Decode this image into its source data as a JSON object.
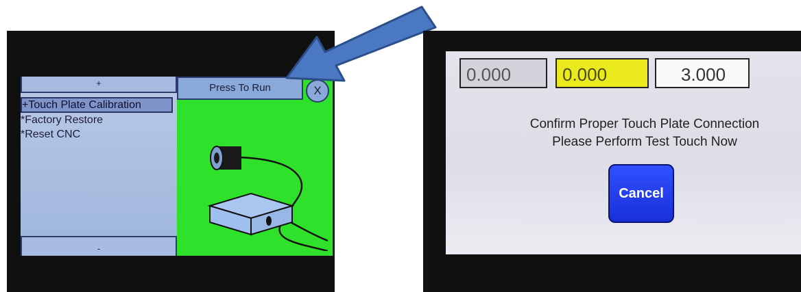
{
  "left_screen": {
    "scroll_up_label": "+",
    "menu_items": [
      {
        "label": "+Touch Plate Calibration",
        "selected": true
      },
      {
        "label": "*Factory Restore",
        "selected": false
      },
      {
        "label": "*Reset CNC",
        "selected": false
      }
    ],
    "scroll_down_label": "-",
    "run_button_label": "Press To Run",
    "close_button_label": "X"
  },
  "right_screen": {
    "readouts": [
      "0.000",
      "0.000",
      "3.000"
    ],
    "message_line1": "Confirm Proper Touch Plate Connection",
    "message_line2": "Please Perform Test Touch Now",
    "cancel_label": "Cancel"
  },
  "colors": {
    "run_panel_green": "#2fe12a",
    "menu_blue": "#a9bde0",
    "highlight_yellow": "#eaea1e",
    "cancel_blue": "#1f3cf0",
    "arrow_blue": "#4a78c2"
  }
}
